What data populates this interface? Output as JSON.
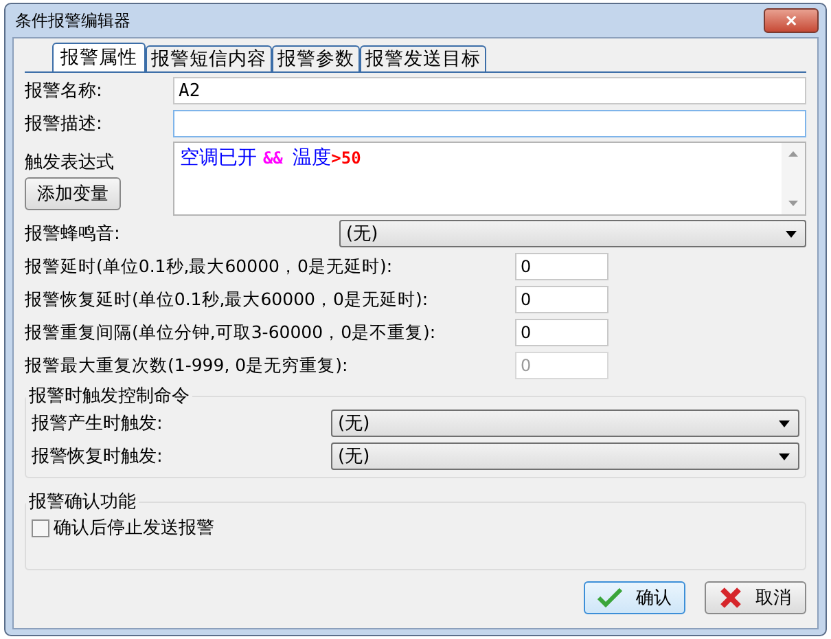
{
  "window": {
    "title": "条件报警编辑器",
    "close": "✕"
  },
  "tabs": [
    {
      "label": "报警属性",
      "selected": true
    },
    {
      "label": "报警短信内容",
      "selected": false
    },
    {
      "label": "报警参数",
      "selected": false
    },
    {
      "label": "报警发送目标",
      "selected": false
    }
  ],
  "name": {
    "label": "报警名称:",
    "value": "A2"
  },
  "description": {
    "label": "报警描述:"
  },
  "expression": {
    "label": "触发表达式",
    "button": "添加变量",
    "parts": [
      {
        "text": "空调已开 ",
        "color": "#0000ff"
      },
      {
        "text": "&& ",
        "color": "#ff00ff"
      },
      {
        "text": "温度",
        "color": "#0000ff"
      },
      {
        "text": ">50",
        "color": "#ff0000"
      }
    ]
  },
  "buzzer": {
    "label": "报警蜂鸣音:",
    "value": "(无)"
  },
  "numbers": [
    {
      "label": "报警延时(单位0.1秒,最大60000，0是无延时):",
      "value": "0",
      "disabled": false
    },
    {
      "label": "报警恢复延时(单位0.1秒,最大60000，0是无延时):",
      "value": "0",
      "disabled": false
    },
    {
      "label": "报警重复间隔(单位分钟,可取3-60000，0是不重复):",
      "value": "0",
      "disabled": false
    },
    {
      "label": "报警最大重复次数(1-999, 0是无穷重复):",
      "value": "0",
      "disabled": true
    }
  ],
  "control_group": {
    "title": "报警时触发控制命令",
    "rows": [
      {
        "label": "报警产生时触发:",
        "value": "(无)"
      },
      {
        "label": "报警恢复时触发:",
        "value": "(无)"
      }
    ]
  },
  "confirm_group": {
    "title": "报警确认功能",
    "checkbox": {
      "label": "确认后停止发送报警",
      "checked": false
    }
  },
  "buttons": [
    {
      "label": "确认",
      "kind": "ok"
    },
    {
      "label": "取消",
      "kind": "cancel"
    }
  ]
}
